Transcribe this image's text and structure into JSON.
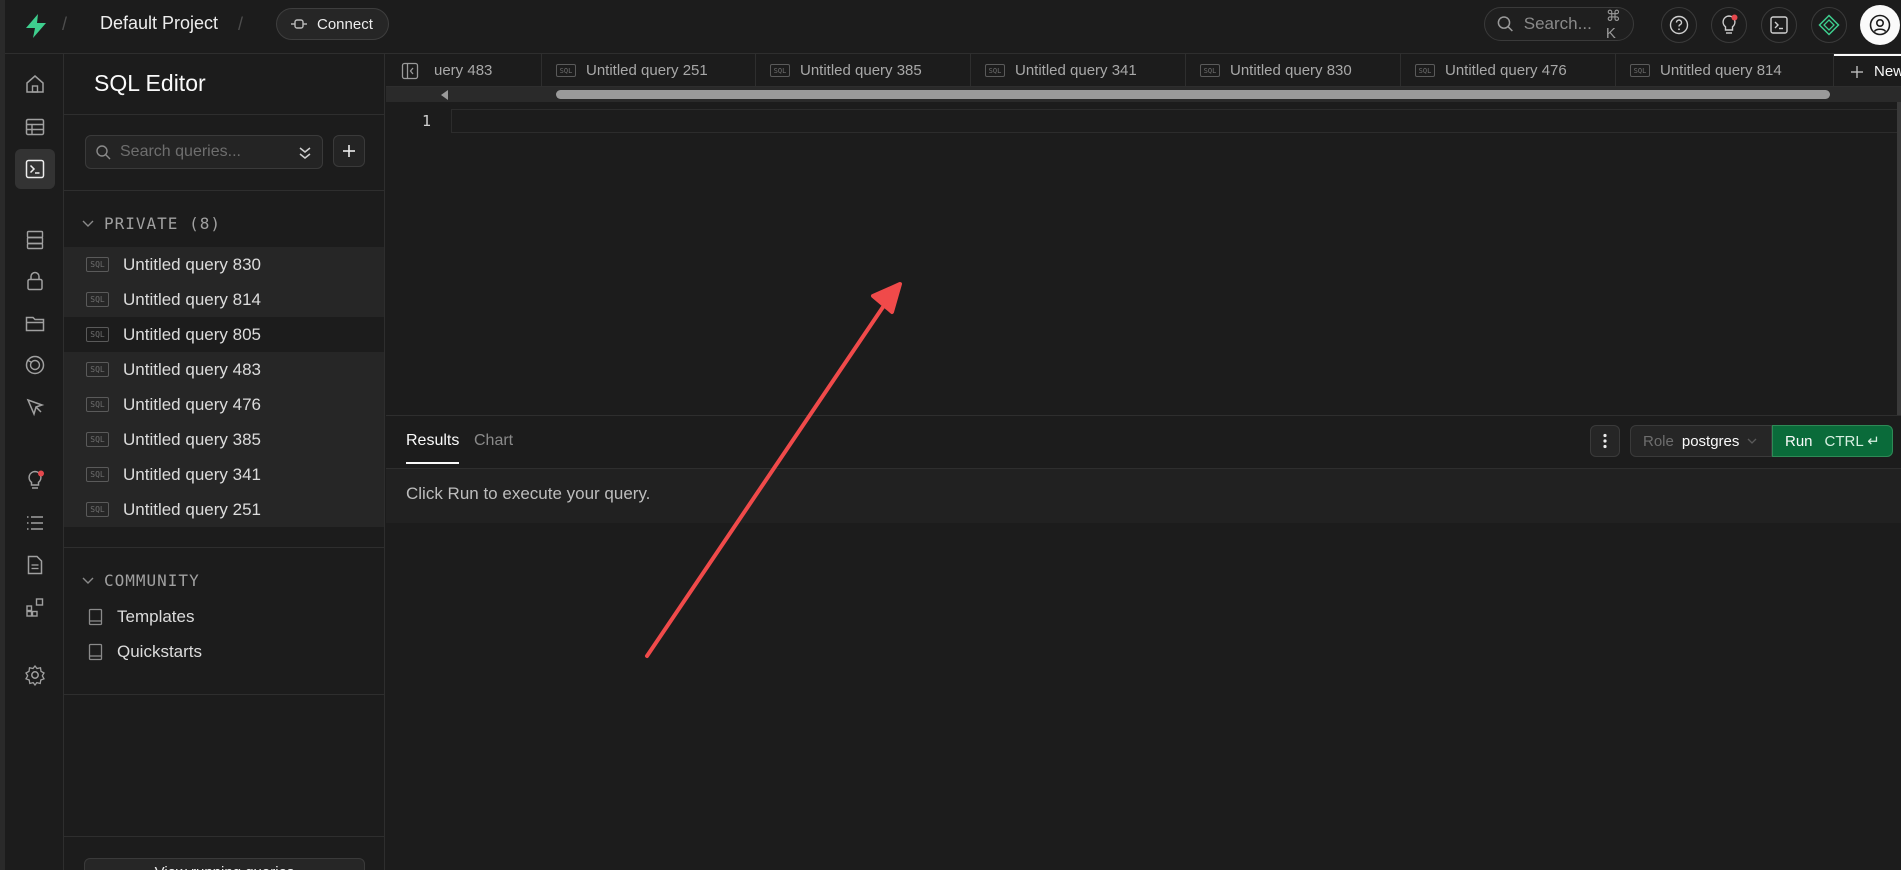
{
  "header": {
    "project_name": "Default Project",
    "connect_label": "Connect",
    "search_placeholder": "Search...",
    "search_shortcut": "⌘ K"
  },
  "sidebar": {
    "title": "SQL Editor",
    "search_placeholder": "Search queries...",
    "private_heading": "PRIVATE (8)",
    "private_queries": [
      "Untitled query 830",
      "Untitled query 814",
      "Untitled query 805",
      "Untitled query 483",
      "Untitled query 476",
      "Untitled query 385",
      "Untitled query 341",
      "Untitled query 251"
    ],
    "selected_query": "Untitled query 805",
    "community_heading": "COMMUNITY",
    "community_items": [
      "Templates",
      "Quickstarts"
    ],
    "footer_button": "View running queries"
  },
  "tabs": {
    "items": [
      "uery 483",
      "Untitled query 251",
      "Untitled query 385",
      "Untitled query 341",
      "Untitled query 830",
      "Untitled query 476",
      "Untitled query 814"
    ],
    "new_tab_label": "New"
  },
  "editor": {
    "line_number": "1",
    "content": ""
  },
  "results": {
    "tab_results": "Results",
    "tab_chart": "Chart",
    "role_key": "Role",
    "role_value": "postgres",
    "run_label": "Run",
    "run_shortcut": "CTRL ↵",
    "empty_message": "Click Run to execute your query."
  },
  "colors": {
    "accent_green": "#3ecf8e",
    "run_button": "#0a6b3a",
    "annotation_arrow": "#f04a4a",
    "notification_dot": "#e5484d"
  }
}
